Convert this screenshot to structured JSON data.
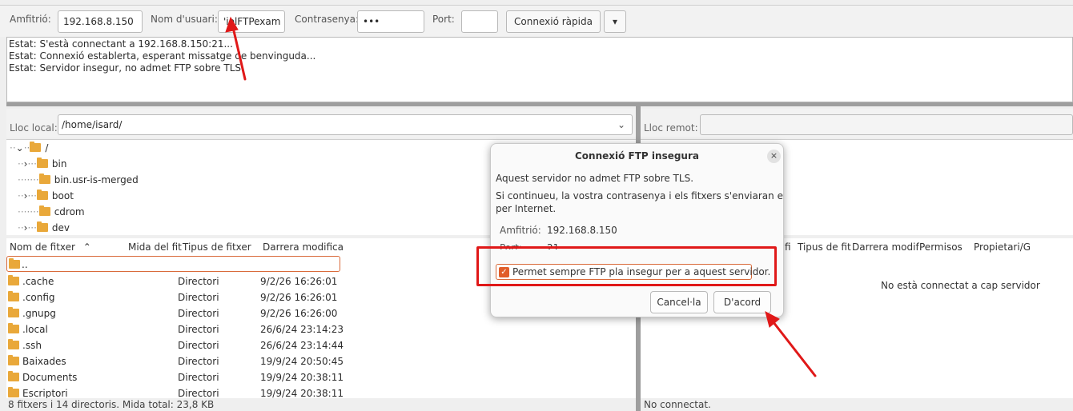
{
  "quickconnect": {
    "host_label": "Amfitrió:",
    "host_value": "192.168.8.150",
    "user_label": "Nom d'usuari:",
    "user_value": "'iolFTPexam",
    "pass_label": "Contrasenya:",
    "pass_value": "•••",
    "port_label": "Port:",
    "port_value": "",
    "connect_label": "Connexió ràpida",
    "dropdown_glyph": "▾"
  },
  "log": {
    "lines": [
      "Estat:  S'està connectant a 192.168.8.150:21...",
      "Estat:  Connexió establerta, esperant missatge de benvinguda...",
      "Estat:  Servidor insegur, no admet FTP sobre TLS."
    ]
  },
  "local": {
    "site_label": "Lloc local:",
    "site_path": "/home/isard/",
    "dropdown_glyph": "⌄",
    "tree": [
      {
        "label": "/",
        "prefix": "⌄"
      },
      {
        "label": "bin",
        "prefix": "›"
      },
      {
        "label": "bin.usr-is-merged",
        "prefix": ""
      },
      {
        "label": "boot",
        "prefix": "›"
      },
      {
        "label": "cdrom",
        "prefix": ""
      },
      {
        "label": "dev",
        "prefix": "›"
      }
    ],
    "columns": [
      "Nom de fitxer",
      "Mida del fit",
      "Tipus de fitxer",
      "Darrera modifica"
    ],
    "sort_glyph": "⌃",
    "rows": [
      {
        "name": "..",
        "type": "",
        "date": ""
      },
      {
        "name": ".cache",
        "type": "Directori",
        "date": "9/2/26 16:26:01"
      },
      {
        "name": ".config",
        "type": "Directori",
        "date": "9/2/26 16:26:01"
      },
      {
        "name": ".gnupg",
        "type": "Directori",
        "date": "9/2/26 16:26:00"
      },
      {
        "name": ".local",
        "type": "Directori",
        "date": "26/6/24 23:14:23"
      },
      {
        "name": ".ssh",
        "type": "Directori",
        "date": "26/6/24 23:14:44"
      },
      {
        "name": "Baixades",
        "type": "Directori",
        "date": "19/9/24 20:50:45"
      },
      {
        "name": "Documents",
        "type": "Directori",
        "date": "19/9/24 20:38:11"
      },
      {
        "name": "Escriptori",
        "type": "Directori",
        "date": "19/9/24 20:38:11"
      }
    ],
    "status": "8 fitxers i 14 directoris. Mida total: 23,8 KB"
  },
  "remote": {
    "site_label": "Lloc remot:",
    "site_path": "",
    "columns": [
      "fi",
      "Tipus de fit",
      "Darrera modif",
      "Permisos",
      "Propietari/G"
    ],
    "empty_message": "No està connectat a cap servidor",
    "status": "No connectat."
  },
  "dialog": {
    "title": "Connexió FTP insegura",
    "close_glyph": "×",
    "line1": "Aquest servidor no admet FTP sobre TLS.",
    "line2a": "Si continueu, la vostra contrasenya i els fitxers s'enviaran en clar",
    "line2b": "per Internet.",
    "host_label": "Amfitrió:",
    "host_value": "192.168.8.150",
    "port_label": "Port:",
    "port_value": "21",
    "checkbox_label": "Permet sempre FTP pla insegur per a aquest servidor.",
    "checkbox_checked": true,
    "check_glyph": "✓",
    "cancel_label": "Cancel·la",
    "ok_label": "D'acord"
  },
  "colors": {
    "accent": "#e15e2a",
    "annotation_red": "#e01818",
    "folder": "#e9a83a"
  }
}
